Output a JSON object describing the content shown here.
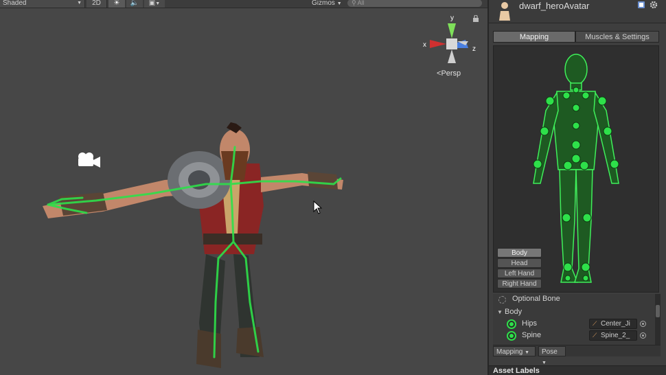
{
  "scene_toolbar": {
    "shading_mode": "Shaded",
    "mode_2d_label": "2D",
    "gizmos_label": "Gizmos",
    "search_placeholder": "All"
  },
  "scene_view": {
    "projection_label": "Persp",
    "axis_labels": {
      "y": "y",
      "x": "x",
      "z": "z"
    }
  },
  "inspector": {
    "asset_title": "dwarf_heroAvatar",
    "tabs": [
      {
        "label": "Mapping",
        "active": true
      },
      {
        "label": "Muscles & Settings",
        "active": false
      }
    ],
    "part_buttons": [
      {
        "label": "Body",
        "active": true
      },
      {
        "label": "Head",
        "active": false
      },
      {
        "label": "Left Hand",
        "active": false
      },
      {
        "label": "Right Hand",
        "active": false
      }
    ],
    "optional_bone_label": "Optional Bone",
    "group_label": "Body",
    "bones": [
      {
        "name": "Hips",
        "mapped": "Center_Ji"
      },
      {
        "name": "Spine",
        "mapped": "Spine_2_"
      }
    ],
    "footer": {
      "mapping_label": "Mapping",
      "pose_label": "Pose"
    },
    "asset_labels_title": "Asset Labels"
  },
  "colors": {
    "bone_green": "#2ee04a",
    "viewport_bg": "#474747",
    "panel_bg": "#3e3e3e"
  }
}
